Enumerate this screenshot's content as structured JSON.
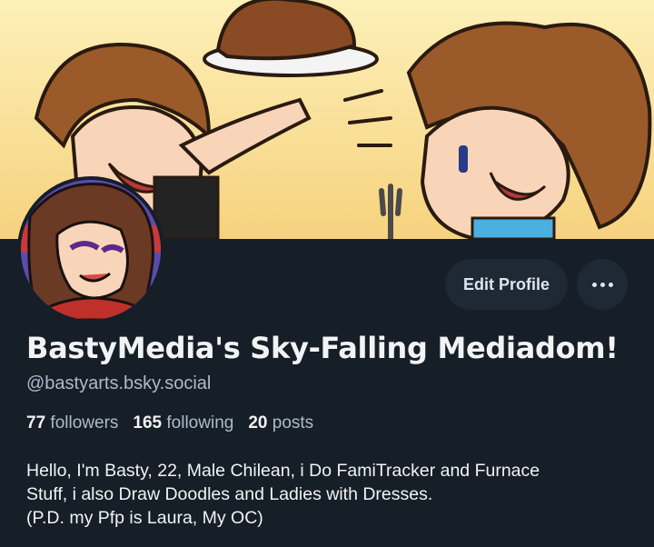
{
  "profile": {
    "display_name": "BastyMedia's Sky-Falling Mediadom!",
    "handle": "@bastyarts.bsky.social"
  },
  "actions": {
    "edit_label": "Edit Profile",
    "more_icon": "ellipsis-icon"
  },
  "stats": {
    "followers_count": "77",
    "followers_label": "followers",
    "following_count": "165",
    "following_label": "following",
    "posts_count": "20",
    "posts_label": "posts"
  },
  "bio": {
    "lines": [
      "Hello, I'm Basty, 22, Male Chilean, i Do FamiTracker and Furnace",
      "Stuff, i also Draw Doodles and Ladies with Dresses.",
      "(P.D. my Pfp is Laura, My OC)"
    ]
  },
  "colors": {
    "background": "#161e27",
    "button_bg": "#1e2936",
    "muted_text": "#aebbc9",
    "banner_sky": "#fbe6a6"
  }
}
